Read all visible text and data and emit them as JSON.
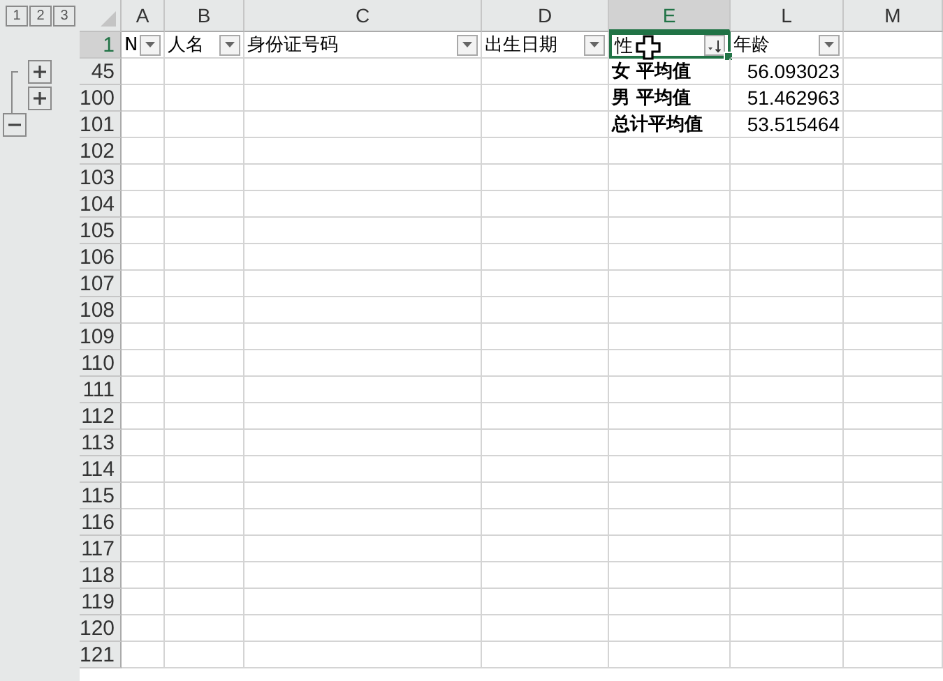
{
  "outline_levels": [
    "1",
    "2",
    "3"
  ],
  "columns": [
    {
      "letter": "A",
      "selected": false
    },
    {
      "letter": "B",
      "selected": false
    },
    {
      "letter": "C",
      "selected": false
    },
    {
      "letter": "D",
      "selected": false
    },
    {
      "letter": "E",
      "selected": true
    },
    {
      "letter": "L",
      "selected": false
    },
    {
      "letter": "M",
      "selected": false
    }
  ],
  "rows": [
    {
      "number": "1",
      "selected": true,
      "kind": "header",
      "cells": {
        "A": {
          "text": "N",
          "sorted": false
        },
        "B": {
          "text": "人名",
          "sorted": false
        },
        "C": {
          "text": "身份证号码",
          "sorted": false
        },
        "D": {
          "text": "出生日期",
          "sorted": false
        },
        "E": {
          "text": "性",
          "sorted": true,
          "active": true
        },
        "L": {
          "text": "年龄",
          "sorted": false
        }
      }
    },
    {
      "number": "45",
      "selected": false,
      "kind": "subtotal",
      "expanded": false,
      "cells": {
        "E": {
          "text": "女 平均值"
        },
        "L": {
          "text": "56.093023"
        }
      }
    },
    {
      "number": "100",
      "selected": false,
      "kind": "subtotal",
      "expanded": false,
      "cells": {
        "E": {
          "text": "男 平均值"
        },
        "L": {
          "text": "51.462963"
        }
      }
    },
    {
      "number": "101",
      "selected": false,
      "kind": "subtotal",
      "expanded": true,
      "cells": {
        "E": {
          "text": "总计平均值"
        },
        "L": {
          "text": "53.515464"
        }
      }
    },
    {
      "number": "102",
      "selected": false
    },
    {
      "number": "103",
      "selected": false
    },
    {
      "number": "104",
      "selected": false
    },
    {
      "number": "105",
      "selected": false
    },
    {
      "number": "106",
      "selected": false
    },
    {
      "number": "107",
      "selected": false
    },
    {
      "number": "108",
      "selected": false
    },
    {
      "number": "109",
      "selected": false
    },
    {
      "number": "110",
      "selected": false
    },
    {
      "number": "111",
      "selected": false
    },
    {
      "number": "112",
      "selected": false
    },
    {
      "number": "113",
      "selected": false
    },
    {
      "number": "114",
      "selected": false
    },
    {
      "number": "115",
      "selected": false
    },
    {
      "number": "116",
      "selected": false
    },
    {
      "number": "117",
      "selected": false
    },
    {
      "number": "118",
      "selected": false
    },
    {
      "number": "119",
      "selected": false
    },
    {
      "number": "120",
      "selected": false
    },
    {
      "number": "121",
      "selected": false
    }
  ]
}
